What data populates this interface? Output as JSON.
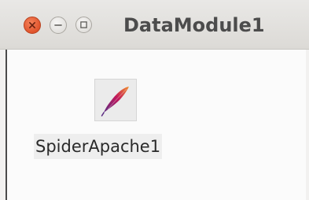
{
  "window": {
    "title": "DataModule1",
    "controls": {
      "close_icon": "close-icon",
      "minimize_icon": "minimize-icon",
      "maximize_icon": "maximize-icon"
    }
  },
  "designer": {
    "components": [
      {
        "label": "SpiderApache1",
        "icon": "apache-feather-icon"
      }
    ]
  },
  "colors": {
    "close_button": "#e0542c",
    "title_text": "#4c4c4c",
    "feather_top": "#f18e2a",
    "feather_mid": "#c2185b",
    "feather_bottom": "#5b2c83"
  }
}
